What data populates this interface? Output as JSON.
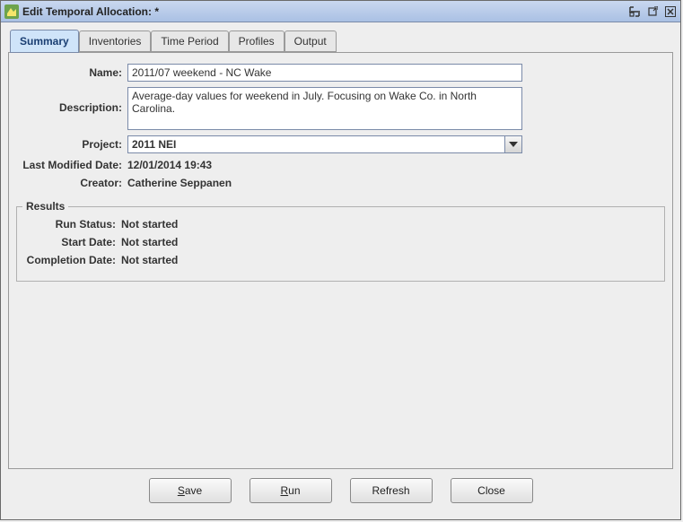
{
  "window": {
    "title": "Edit Temporal Allocation:  *"
  },
  "tabs": {
    "summary": "Summary",
    "inventories": "Inventories",
    "time_period": "Time Period",
    "profiles": "Profiles",
    "output": "Output"
  },
  "form": {
    "labels": {
      "name": "Name:",
      "description": "Description:",
      "project": "Project:",
      "last_modified": "Last Modified Date:",
      "creator": "Creator:"
    },
    "name_value": "2011/07 weekend - NC Wake",
    "description_value": "Average-day values for weekend in July. Focusing on Wake Co. in North Carolina.",
    "project_value": "2011 NEI",
    "last_modified_value": "12/01/2014 19:43",
    "creator_value": "Catherine Seppanen"
  },
  "results": {
    "legend": "Results",
    "labels": {
      "run_status": "Run Status:",
      "start_date": "Start Date:",
      "completion_date": "Completion Date:"
    },
    "run_status_value": "Not started",
    "start_date_value": "Not started",
    "completion_date_value": "Not started"
  },
  "buttons": {
    "save": "ave",
    "save_mn": "S",
    "run": "un",
    "run_mn": "R",
    "refresh": "Refresh",
    "close": "Close"
  }
}
